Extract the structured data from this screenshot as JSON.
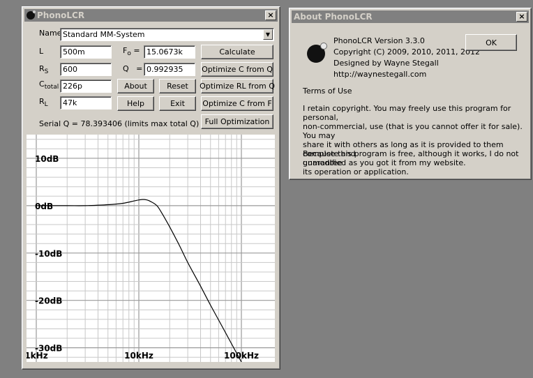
{
  "main_window": {
    "title": "PhonoLCR",
    "close": "×",
    "name_label": "Name",
    "name_value": "Standard MM-System",
    "dropdown_arrow": "▼",
    "fields": {
      "L": {
        "label": "L",
        "value": "500m"
      },
      "Rs": {
        "label": "R",
        "sub": "S",
        "value": "600"
      },
      "Ctotal": {
        "label": "C",
        "sub": "total",
        "value": "226p"
      },
      "RL": {
        "label": "R",
        "sub": "L",
        "value": "47k"
      },
      "Fo": {
        "label": "F",
        "sub": "o",
        "eq": "=",
        "value": "15.0673k"
      },
      "Q": {
        "label": "Q",
        "eq": "=",
        "value": "0.992935"
      }
    },
    "buttons": {
      "about": "About",
      "reset": "Reset",
      "help": "Help",
      "exit": "Exit",
      "calculate": "Calculate",
      "opt_c_q": "Optimize C from Q",
      "opt_rl_q": "Optimize RL from Q",
      "opt_c_f": "Optimize C from F",
      "full_opt": "Full Optimization"
    },
    "serial_q": "Serial Q = 78.393406 (limits max total Q)"
  },
  "chart_data": {
    "type": "line",
    "x_scale": "log",
    "xlim": [
      1000,
      100000
    ],
    "ylim": [
      -33,
      15
    ],
    "grid": true,
    "y_ticks": [
      {
        "v": 10,
        "label": "10dB"
      },
      {
        "v": 0,
        "label": "0dB"
      },
      {
        "v": -10,
        "label": "-10dB"
      },
      {
        "v": -20,
        "label": "-20dB"
      },
      {
        "v": -30,
        "label": "-30dB"
      }
    ],
    "x_ticks": [
      {
        "v": 1000,
        "label": "1kHz"
      },
      {
        "v": 10000,
        "label": "10kHz"
      },
      {
        "v": 100000,
        "label": "100kHz"
      }
    ],
    "line_color": "#000000",
    "grid_color": "#c8c8c8",
    "series": [
      {
        "x": [
          1000,
          2000,
          3000,
          5000,
          7000,
          9000,
          10000,
          11000,
          12000,
          13000,
          15000,
          17000,
          20000,
          25000,
          30000,
          40000,
          50000,
          70000,
          100000
        ],
        "y": [
          0,
          0,
          0,
          0.2,
          0.5,
          1.0,
          1.2,
          1.3,
          1.2,
          0.9,
          0,
          -1.8,
          -4.5,
          -8.5,
          -12,
          -17,
          -21,
          -26.8,
          -33
        ]
      }
    ]
  },
  "about_window": {
    "title": "About PhonoLCR",
    "close": "×",
    "ok": "OK",
    "version": "PhonoLCR Version 3.3.0",
    "copyright": "Copyright (C) 2009, 2010, 2011, 2012",
    "designed": "Designed by Wayne Stegall",
    "url": "http://waynestegall.com",
    "terms_heading": "Terms of Use",
    "para1": [
      "I retain copyright.  You may freely use this program for personal,",
      "non-commercial, use (that is you cannot offer it for sale).  You may",
      "share it with others as long as it is provided to them complete and",
      "unmodified as you got it from my website."
    ],
    "para2": [
      "Because this program is free, although it works, I do not guarantee",
      "its operation or application."
    ]
  }
}
